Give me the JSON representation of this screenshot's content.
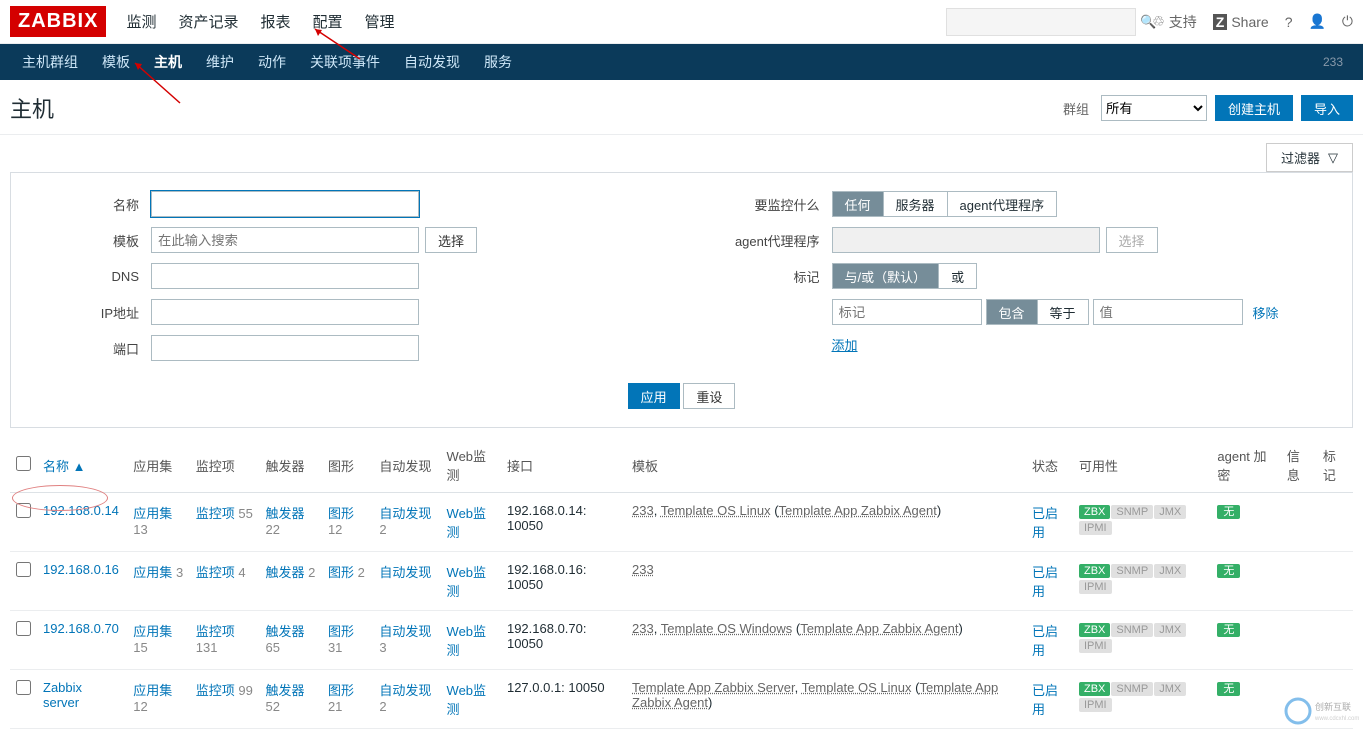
{
  "logo": "ZABBIX",
  "mainnav": [
    "监测",
    "资产记录",
    "报表",
    "配置",
    "管理"
  ],
  "mainnav_active": 3,
  "topright": {
    "support": "支持",
    "share": "Share"
  },
  "subnav": [
    "主机群组",
    "模板",
    "主机",
    "维护",
    "动作",
    "关联项事件",
    "自动发现",
    "服务"
  ],
  "subnav_active": 2,
  "subnav_count": "233",
  "page_title": "主机",
  "group_label": "群组",
  "group_value": "所有",
  "btn_create": "创建主机",
  "btn_import": "导入",
  "filter_tab": "过滤器",
  "filter": {
    "name_label": "名称",
    "template_label": "模板",
    "template_placeholder": "在此输入搜索",
    "template_select": "选择",
    "dns_label": "DNS",
    "ip_label": "IP地址",
    "port_label": "端口",
    "monitor_label": "要监控什么",
    "monitor_opts": [
      "任何",
      "服务器",
      "agent代理程序"
    ],
    "proxy_label": "agent代理程序",
    "proxy_select": "选择",
    "tags_label": "标记",
    "tags_mode": [
      "与/或（默认）",
      "或"
    ],
    "tag_key_placeholder": "标记",
    "tag_op_opts": [
      "包含",
      "等于"
    ],
    "tag_val_placeholder": "值",
    "tag_remove": "移除",
    "tag_add": "添加",
    "apply": "应用",
    "reset": "重设"
  },
  "headers": [
    "名称 ▲",
    "应用集",
    "监控项",
    "触发器",
    "图形",
    "自动发现",
    "Web监测",
    "接口",
    "模板",
    "状态",
    "可用性",
    "agent 加密",
    "信息",
    "标记"
  ],
  "rows": [
    {
      "name": "192.168.0.14",
      "apps": {
        "l": "应用集",
        "c": "13"
      },
      "items": {
        "l": "监控项",
        "c": "55"
      },
      "triggers": {
        "l": "触发器",
        "c": "22"
      },
      "graphs": {
        "l": "图形",
        "c": "12"
      },
      "disc": {
        "l": "自动发现",
        "c": "2"
      },
      "web": "Web监测",
      "iface": "192.168.0.14: 10050",
      "tpl_pre": "233, ",
      "tpl_main": "Template OS Linux",
      "tpl_sub": "Template App Zabbix Agent",
      "status": "已启用",
      "enc": "无"
    },
    {
      "name": "192.168.0.16",
      "apps": {
        "l": "应用集",
        "c": "3"
      },
      "items": {
        "l": "监控项",
        "c": "4"
      },
      "triggers": {
        "l": "触发器",
        "c": "2"
      },
      "graphs": {
        "l": "图形",
        "c": "2"
      },
      "disc": {
        "l": "自动发现",
        "c": ""
      },
      "web": "Web监测",
      "iface": "192.168.0.16: 10050",
      "tpl_pre": "",
      "tpl_main": "233",
      "tpl_sub": "",
      "status": "已启用",
      "enc": "无"
    },
    {
      "name": "192.168.0.70",
      "apps": {
        "l": "应用集",
        "c": "15"
      },
      "items": {
        "l": "监控项",
        "c": "131"
      },
      "triggers": {
        "l": "触发器",
        "c": "65"
      },
      "graphs": {
        "l": "图形",
        "c": "31"
      },
      "disc": {
        "l": "自动发现",
        "c": "3"
      },
      "web": "Web监测",
      "iface": "192.168.0.70: 10050",
      "tpl_pre": "233, ",
      "tpl_main": "Template OS Windows",
      "tpl_sub": "Template App Zabbix Agent",
      "status": "已启用",
      "enc": "无"
    },
    {
      "name": "Zabbix server",
      "apps": {
        "l": "应用集",
        "c": "12"
      },
      "items": {
        "l": "监控项",
        "c": "99"
      },
      "triggers": {
        "l": "触发器",
        "c": "52"
      },
      "graphs": {
        "l": "图形",
        "c": "21"
      },
      "disc": {
        "l": "自动发现",
        "c": "2"
      },
      "web": "Web监测",
      "iface": "127.0.0.1: 10050",
      "tpl_pre": "",
      "tpl_main": "Template App Zabbix Server",
      "tpl_main2": "Template OS Linux",
      "tpl_sub": "Template App Zabbix Agent",
      "status": "已启用",
      "enc": "无"
    }
  ],
  "avail_labels": [
    "ZBX",
    "SNMP",
    "JMX",
    "IPMI"
  ]
}
